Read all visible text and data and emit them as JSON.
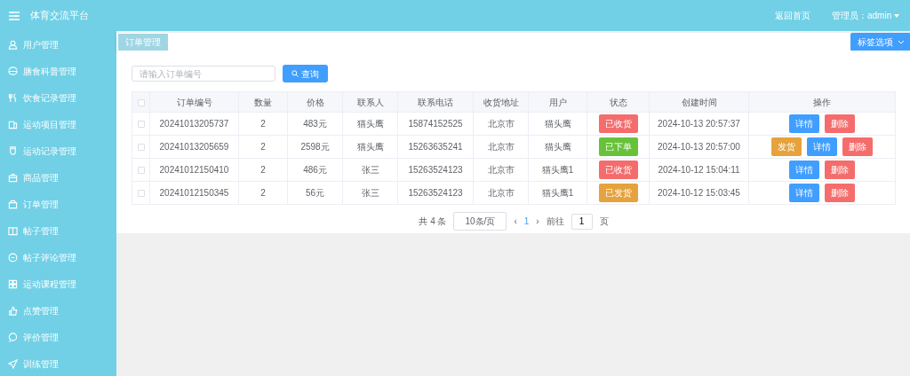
{
  "header": {
    "title": "体育交流平台",
    "links": [
      {
        "label": "返回首页"
      },
      {
        "label": "管理员：admin",
        "dropdown": true
      }
    ]
  },
  "sidebar": {
    "items": [
      {
        "label": "用户管理",
        "selected": false
      },
      {
        "label": "膳食科普管理",
        "selected": false
      },
      {
        "label": "饮食记录管理",
        "selected": false
      },
      {
        "label": "运动项目管理",
        "selected": false
      },
      {
        "label": "运动记录管理",
        "selected": false
      },
      {
        "label": "商品管理",
        "selected": false
      },
      {
        "label": "订单管理",
        "selected": false
      },
      {
        "label": "帖子管理",
        "selected": false
      },
      {
        "label": "帖子评论管理",
        "selected": false
      },
      {
        "label": "运动课程管理",
        "selected": false
      },
      {
        "label": "点赞管理",
        "selected": false
      },
      {
        "label": "评价管理",
        "selected": false
      },
      {
        "label": "训练管理",
        "selected": false
      }
    ]
  },
  "tabs": [
    {
      "label": "订单管理",
      "selected": true
    }
  ],
  "tab_options": {
    "label": "标签选项"
  },
  "search": {
    "placeholder": "请输入订单编号",
    "button": "查询"
  },
  "table": {
    "all_checked": false,
    "columns": [
      "订单编号",
      "数量",
      "价格",
      "联系人",
      "联系电话",
      "收货地址",
      "用户",
      "状态",
      "创建时间",
      "操作"
    ],
    "rows": [
      {
        "checked": false,
        "cells": [
          "20241013205737",
          "2",
          "483元",
          "猫头鹰",
          "15874152525",
          "北京市",
          "猫头鹰"
        ],
        "status": "已收货",
        "color": "#f56c6c",
        "created": "2024-10-13 20:57:37",
        "actions": [
          {
            "label": "详情",
            "kind": "primary"
          },
          {
            "label": "删除",
            "kind": "danger"
          }
        ]
      },
      {
        "checked": false,
        "cells": [
          "20241013205659",
          "2",
          "2598元",
          "猫头鹰",
          "15263635241",
          "北京市",
          "猫头鹰"
        ],
        "status": "已下单",
        "color": "#67c23a",
        "created": "2024-10-13 20:57:00",
        "actions": [
          {
            "label": "发货",
            "kind": "warning"
          },
          {
            "label": "详情",
            "kind": "primary"
          },
          {
            "label": "删除",
            "kind": "danger"
          }
        ]
      },
      {
        "checked": false,
        "cells": [
          "20241012150410",
          "2",
          "486元",
          "张三",
          "15263524123",
          "北京市",
          "猫头鹰1"
        ],
        "status": "已收货",
        "color": "#f56c6c",
        "created": "2024-10-12 15:04:11",
        "actions": [
          {
            "label": "详情",
            "kind": "primary"
          },
          {
            "label": "删除",
            "kind": "danger"
          }
        ]
      },
      {
        "checked": false,
        "cells": [
          "20241012150345",
          "2",
          "56元",
          "张三",
          "15263524123",
          "北京市",
          "猫头鹰1"
        ],
        "status": "已发货",
        "color": "#e6a23c",
        "created": "2024-10-12 15:03:45",
        "actions": [
          {
            "label": "详情",
            "kind": "primary"
          },
          {
            "label": "删除",
            "kind": "danger"
          }
        ]
      }
    ]
  },
  "pagination": {
    "total": "共 4 条",
    "page_size": "10条/页",
    "prev": "‹",
    "pages": [
      {
        "label": "1",
        "selected": true
      }
    ],
    "next": "›",
    "goto_label": "前往",
    "goto_value": "1",
    "goto_suffix": "页"
  }
}
